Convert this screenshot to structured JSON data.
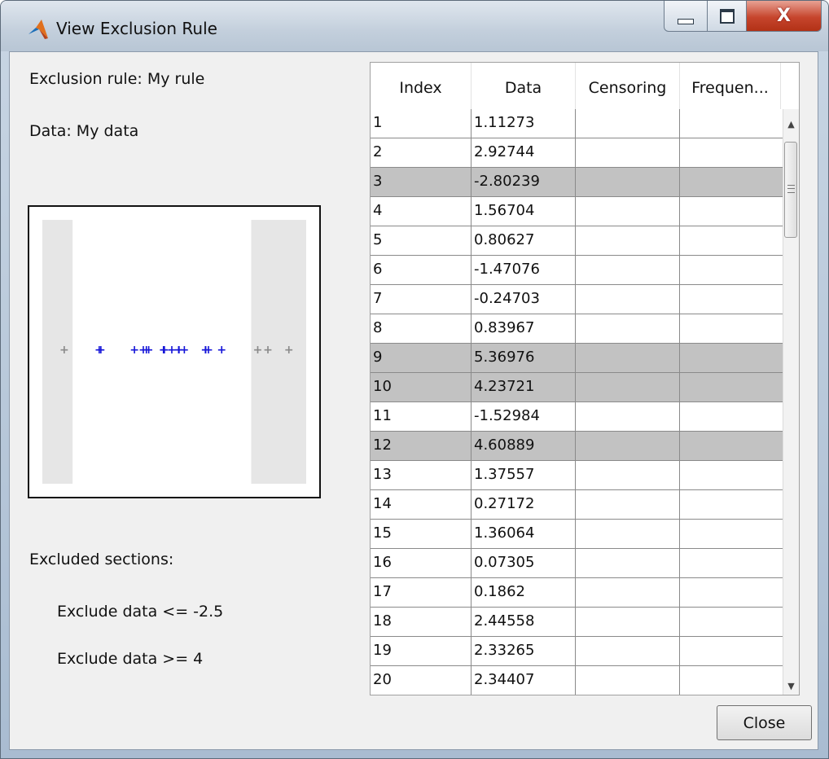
{
  "window": {
    "title": "View Exclusion Rule",
    "icon": "matlab-icon",
    "controls": [
      "minimize",
      "maximize",
      "close"
    ]
  },
  "left": {
    "rule_text": "Exclusion rule: My rule",
    "data_text": "Data: My data",
    "excluded_heading": "Excluded sections:",
    "exclusions": [
      "Exclude data <= -2.5",
      "Exclude data >= 4"
    ]
  },
  "plot": {
    "excluded_below": -2.5,
    "excluded_above": 4,
    "colors": {
      "included": "#1515d8",
      "excluded": "#8a8a8a",
      "shade": "#e6e6e6"
    }
  },
  "table": {
    "columns": [
      "Index",
      "Data",
      "Censoring",
      "Frequen..."
    ],
    "rows": [
      {
        "index": "1",
        "data": "1.11273",
        "excluded": false
      },
      {
        "index": "2",
        "data": "2.92744",
        "excluded": false
      },
      {
        "index": "3",
        "data": "-2.80239",
        "excluded": true
      },
      {
        "index": "4",
        "data": "1.56704",
        "excluded": false
      },
      {
        "index": "5",
        "data": "0.80627",
        "excluded": false
      },
      {
        "index": "6",
        "data": "-1.47076",
        "excluded": false
      },
      {
        "index": "7",
        "data": "-0.24703",
        "excluded": false
      },
      {
        "index": "8",
        "data": "0.83967",
        "excluded": false
      },
      {
        "index": "9",
        "data": "5.36976",
        "excluded": true
      },
      {
        "index": "10",
        "data": "4.23721",
        "excluded": true
      },
      {
        "index": "11",
        "data": "-1.52984",
        "excluded": false
      },
      {
        "index": "12",
        "data": "4.60889",
        "excluded": true
      },
      {
        "index": "13",
        "data": "1.37557",
        "excluded": false
      },
      {
        "index": "14",
        "data": "0.27172",
        "excluded": false
      },
      {
        "index": "15",
        "data": "1.36064",
        "excluded": false
      },
      {
        "index": "16",
        "data": "0.07305",
        "excluded": false
      },
      {
        "index": "17",
        "data": "0.1862",
        "excluded": false
      },
      {
        "index": "18",
        "data": "2.44558",
        "excluded": false
      },
      {
        "index": "19",
        "data": "2.33265",
        "excluded": false
      },
      {
        "index": "20",
        "data": "2.34407",
        "excluded": false
      }
    ]
  },
  "buttons": {
    "close": "Close"
  }
}
